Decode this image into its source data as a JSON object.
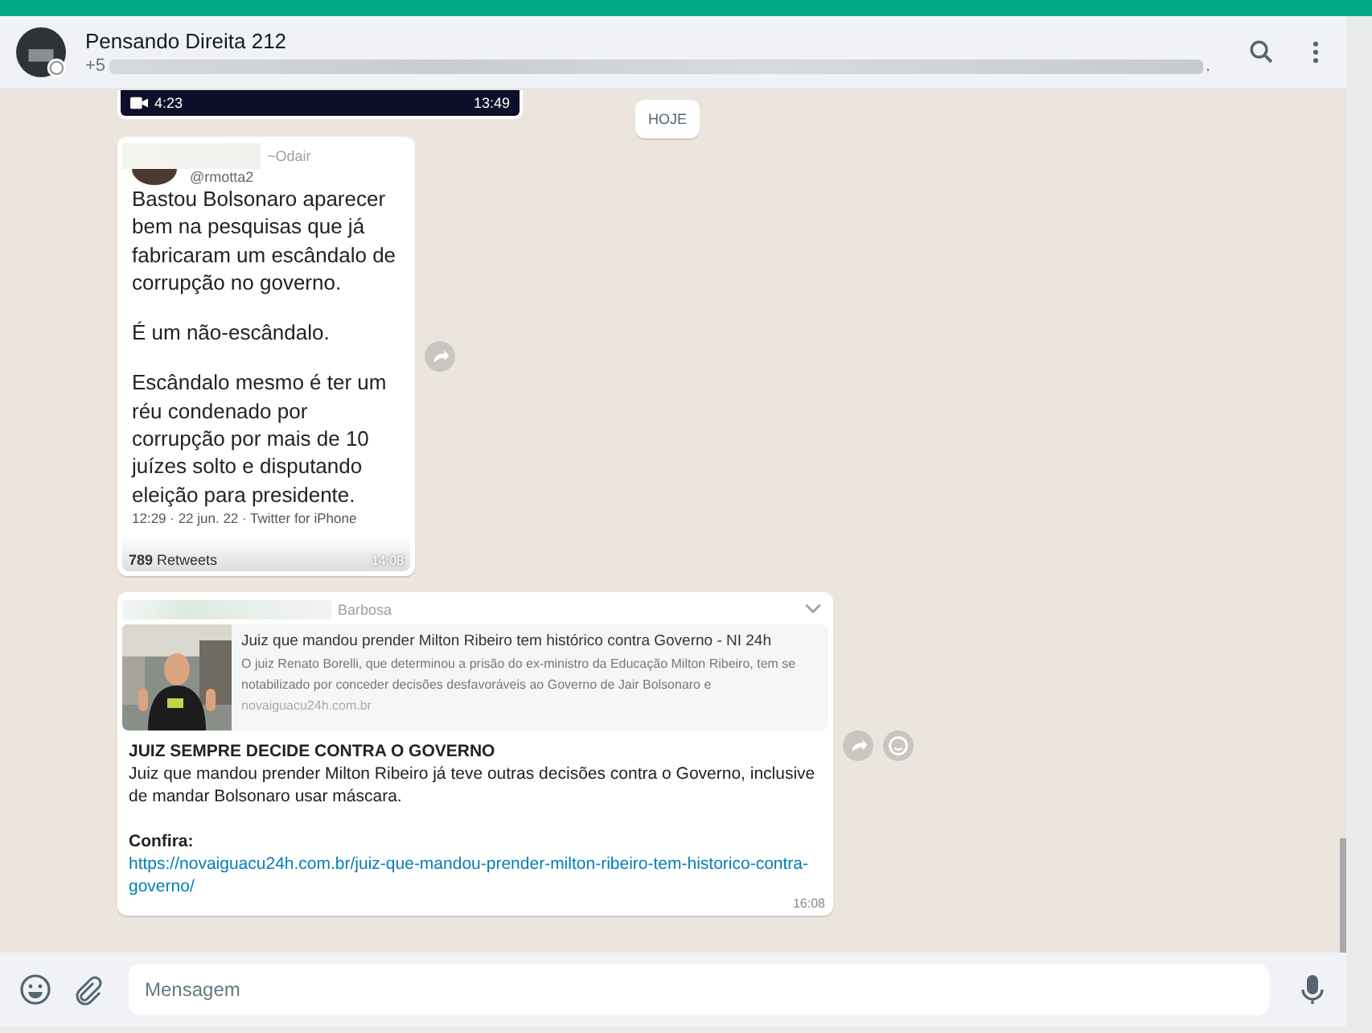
{
  "header": {
    "title": "Pensando Direita 212",
    "subtitle": "+5",
    "subtitle_end": "."
  },
  "messages": [
    {
      "kind": "video",
      "duration": "4:23",
      "time": "13:49"
    },
    {
      "kind": "date",
      "label": "HOJE"
    },
    {
      "kind": "tweet",
      "sender": "~Odair",
      "handle": "@rmotta2",
      "paragraphs": [
        "Bastou Bolsonaro aparecer bem na pesquisas que já fabricaram um escândalo de corrupção no governo.",
        "É um não-escândalo.",
        "Escândalo mesmo é ter um réu condenado por corrupção por mais de 10 juízes solto e disputando eleição para presidente."
      ],
      "meta": "12:29 · 22 jun. 22 · Twitter for iPhone",
      "retweets": "**789** Retweets",
      "time": "14:08"
    },
    {
      "kind": "link",
      "sender": "Barbosa",
      "preview_title": "Juiz que mandou prender Milton Ribeiro tem histórico contra Governo - NI 24h",
      "preview_text": "O juiz Renato Borelli, que determinou a prisão do ex-ministro da Educação Milton Ribeiro, tem se notabilizado por conceder decisões desfavoráveis ao Governo de Jair Bolsonaro e",
      "preview_domain": "novaiguacu24h.com.br",
      "heading": "JUIZ SEMPRE DECIDE CONTRA O GOVERNO",
      "text": "Juiz que mandou prender Milton Ribeiro já teve outras decisões contra o Governo, inclusive de mandar Bolsonaro usar máscara.",
      "label": "Confira:",
      "url": "https://novaiguacu24h.com.br/juiz-que-mandou-prender-milton-ribeiro-tem-historico-contra-governo/",
      "time": "16:08"
    }
  ],
  "composer": {
    "placeholder": "Mensagem"
  }
}
